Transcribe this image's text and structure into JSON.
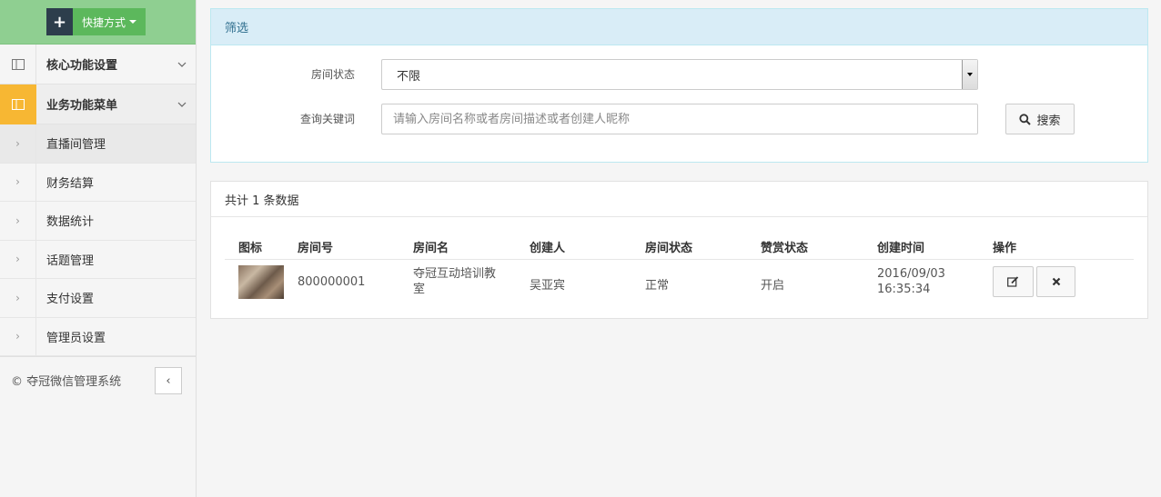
{
  "sidebar": {
    "shortcut_label": "快捷方式",
    "groups": [
      {
        "label": "核心功能设置",
        "active": false
      },
      {
        "label": "业务功能菜单",
        "active": true
      }
    ],
    "items": [
      {
        "label": "直播间管理"
      },
      {
        "label": "财务结算"
      },
      {
        "label": "数据统计"
      },
      {
        "label": "话题管理"
      },
      {
        "label": "支付设置"
      },
      {
        "label": "管理员设置"
      }
    ],
    "footer": "© 夺冠微信管理系统",
    "collapse_icon": "‹"
  },
  "filter": {
    "title": "筛选",
    "status_label": "房间状态",
    "status_value": "不限",
    "keyword_label": "查询关键词",
    "keyword_placeholder": "请输入房间名称或者房间描述或者创建人昵称",
    "search_label": "搜索"
  },
  "list": {
    "summary": "共计 1 条数据",
    "columns": [
      "图标",
      "房间号",
      "房间名",
      "创建人",
      "房间状态",
      "赞赏状态",
      "创建时间",
      "操作"
    ],
    "rows": [
      {
        "room_no": "800000001",
        "room_name_line1": "夺冠互动培训教",
        "room_name_line2": "室",
        "creator": "吴亚宾",
        "room_status": "正常",
        "reward_status": "开启",
        "created_date": "2016/09/03",
        "created_time": "16:35:34"
      }
    ]
  },
  "colors": {
    "shortcut_bar": "#8fcf91",
    "active_group_icon": "#f7b733",
    "filter_header": "#d9edf7",
    "filter_title": "#31708f"
  }
}
